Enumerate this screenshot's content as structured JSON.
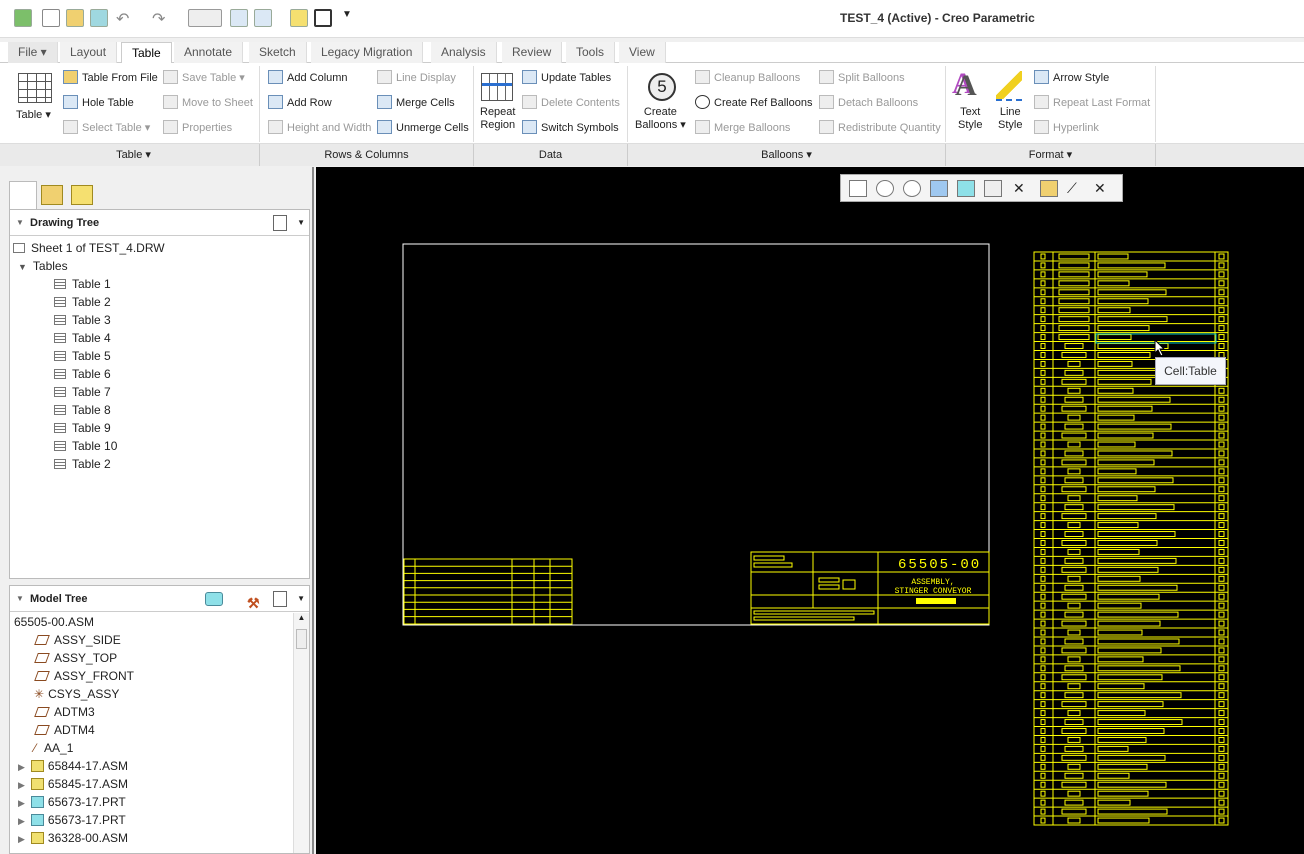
{
  "window": {
    "title": "TEST_4 (Active) - Creo Parametric"
  },
  "quick_access": [
    "app-icon",
    "new-icon",
    "open-icon",
    "save-icon",
    "undo-icon",
    "redo-icon",
    "select-box-icon",
    "regenerate-icon",
    "windows-icon",
    "folder-icon",
    "text-icon",
    "customize-icon"
  ],
  "tabs": [
    {
      "label": "File ▾"
    },
    {
      "label": "Layout"
    },
    {
      "label": "Table",
      "active": true
    },
    {
      "label": "Annotate"
    },
    {
      "label": "Sketch"
    },
    {
      "label": "Legacy Migration"
    },
    {
      "label": "Analysis"
    },
    {
      "label": "Review"
    },
    {
      "label": "Tools"
    },
    {
      "label": "View"
    }
  ],
  "ribbon": {
    "table": {
      "big": "Table ▾",
      "items": [
        "Table From File",
        "Hole Table",
        "Select Table ▾",
        "Save Table ▾",
        "Move to Sheet",
        "Properties"
      ],
      "group": "Table ▾"
    },
    "rows_columns": {
      "items": [
        "Add Column",
        "Add Row",
        "Height and Width",
        "Line Display",
        "Merge Cells",
        "Unmerge Cells"
      ],
      "group": "Rows & Columns"
    },
    "data": {
      "big1": "Repeat",
      "big2": "Region",
      "items": [
        "Update Tables",
        "Delete Contents",
        "Switch Symbols"
      ],
      "group": "Data"
    },
    "balloons": {
      "big1": "Create",
      "big2": "Balloons ▾",
      "balloon_glyph": "5",
      "items": [
        "Cleanup Balloons",
        "Create Ref Balloons",
        "Merge Balloons",
        "Split Balloons",
        "Detach Balloons",
        "Redistribute Quantity"
      ],
      "group": "Balloons ▾"
    },
    "format": {
      "text1": "Text",
      "text2": "Style",
      "line1": "Line",
      "line2": "Style",
      "items": [
        "Arrow Style",
        "Repeat Last Format",
        "Hyperlink"
      ],
      "group": "Format ▾"
    }
  },
  "drawing_tree": {
    "title": "Drawing Tree",
    "sheet": "Sheet 1 of TEST_4.DRW",
    "folder": "Tables",
    "items": [
      "Table 1",
      "Table 2",
      "Table 3",
      "Table 4",
      "Table 5",
      "Table 6",
      "Table 7",
      "Table 8",
      "Table 9",
      "Table 10",
      "Table 2"
    ]
  },
  "model_tree": {
    "title": "Model Tree",
    "root": "65505-00.ASM",
    "items": [
      {
        "label": "ASSY_SIDE",
        "icon": "datum-plane-icon"
      },
      {
        "label": "ASSY_TOP",
        "icon": "datum-plane-icon"
      },
      {
        "label": "ASSY_FRONT",
        "icon": "datum-plane-icon"
      },
      {
        "label": "CSYS_ASSY",
        "icon": "csys-icon"
      },
      {
        "label": "ADTM3",
        "icon": "datum-plane-icon"
      },
      {
        "label": "ADTM4",
        "icon": "datum-plane-icon"
      },
      {
        "label": "AA_1",
        "icon": "axis-icon"
      },
      {
        "label": "65844-17.ASM",
        "icon": "assembly-icon"
      },
      {
        "label": "65845-17.ASM",
        "icon": "assembly-icon"
      },
      {
        "label": "65673-17.PRT",
        "icon": "part-icon"
      },
      {
        "label": "65673-17.PRT",
        "icon": "part-icon"
      },
      {
        "label": "36328-00.ASM",
        "icon": "assembly-icon"
      }
    ]
  },
  "drawing": {
    "part_number": "65505-00",
    "title1": "ASSEMBLY,",
    "title2": "STINGER CONVEYOR"
  },
  "tooltip": "Cell:Table",
  "colors": {
    "canvas": "#000000",
    "drawing_lines": "#ffff00",
    "highlight": "#00c0c0"
  }
}
